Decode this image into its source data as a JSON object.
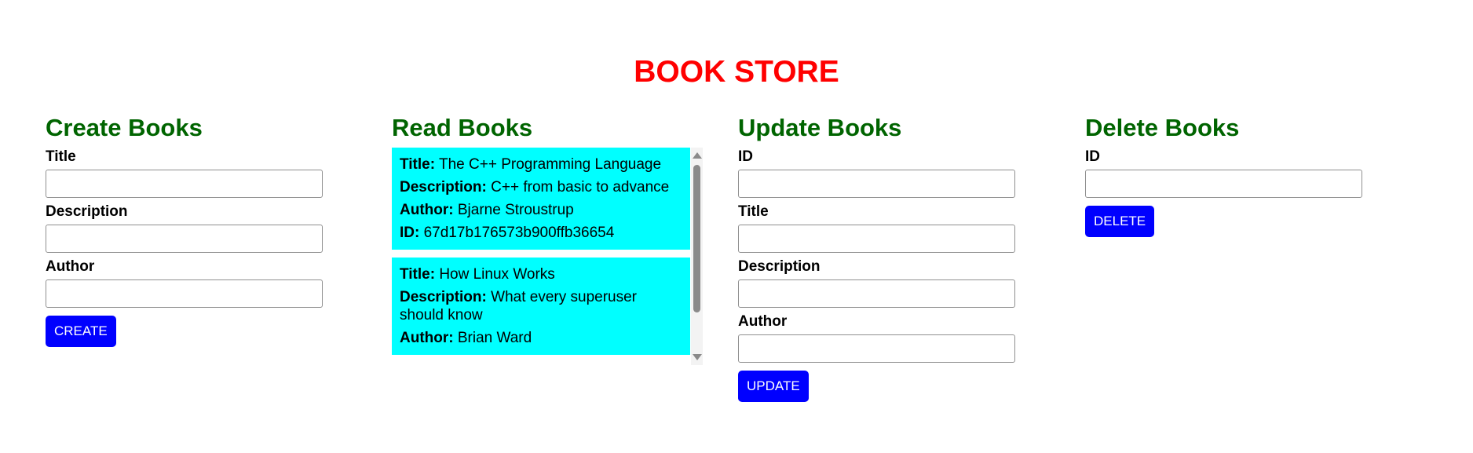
{
  "page": {
    "title": "BOOK STORE"
  },
  "colors": {
    "title": "#ff0000",
    "heading": "#006400",
    "button": "#0000ff",
    "card": "#00ffff"
  },
  "create": {
    "heading": "Create Books",
    "title_label": "Title",
    "title_value": "",
    "description_label": "Description",
    "description_value": "",
    "author_label": "Author",
    "author_value": "",
    "button_label": "CREATE"
  },
  "read": {
    "heading": "Read Books",
    "keys": {
      "title": "Title:",
      "description": "Description:",
      "author": "Author:",
      "id": "ID:"
    },
    "books": [
      {
        "title": "The C++ Programming Language",
        "description": "C++ from basic to advance",
        "author": "Bjarne Stroustrup",
        "id": "67d17b176573b900ffb36654"
      },
      {
        "title": "How Linux Works",
        "description": "What every superuser should know",
        "author": "Brian Ward"
      }
    ]
  },
  "update": {
    "heading": "Update Books",
    "id_label": "ID",
    "id_value": "",
    "title_label": "Title",
    "title_value": "",
    "description_label": "Description",
    "description_value": "",
    "author_label": "Author",
    "author_value": "",
    "button_label": "UPDATE"
  },
  "delete": {
    "heading": "Delete Books",
    "id_label": "ID",
    "id_value": "",
    "button_label": "DELETE"
  },
  "icons": {
    "scroll_up": "scroll-up-arrow-icon",
    "scroll_down": "scroll-down-arrow-icon"
  }
}
